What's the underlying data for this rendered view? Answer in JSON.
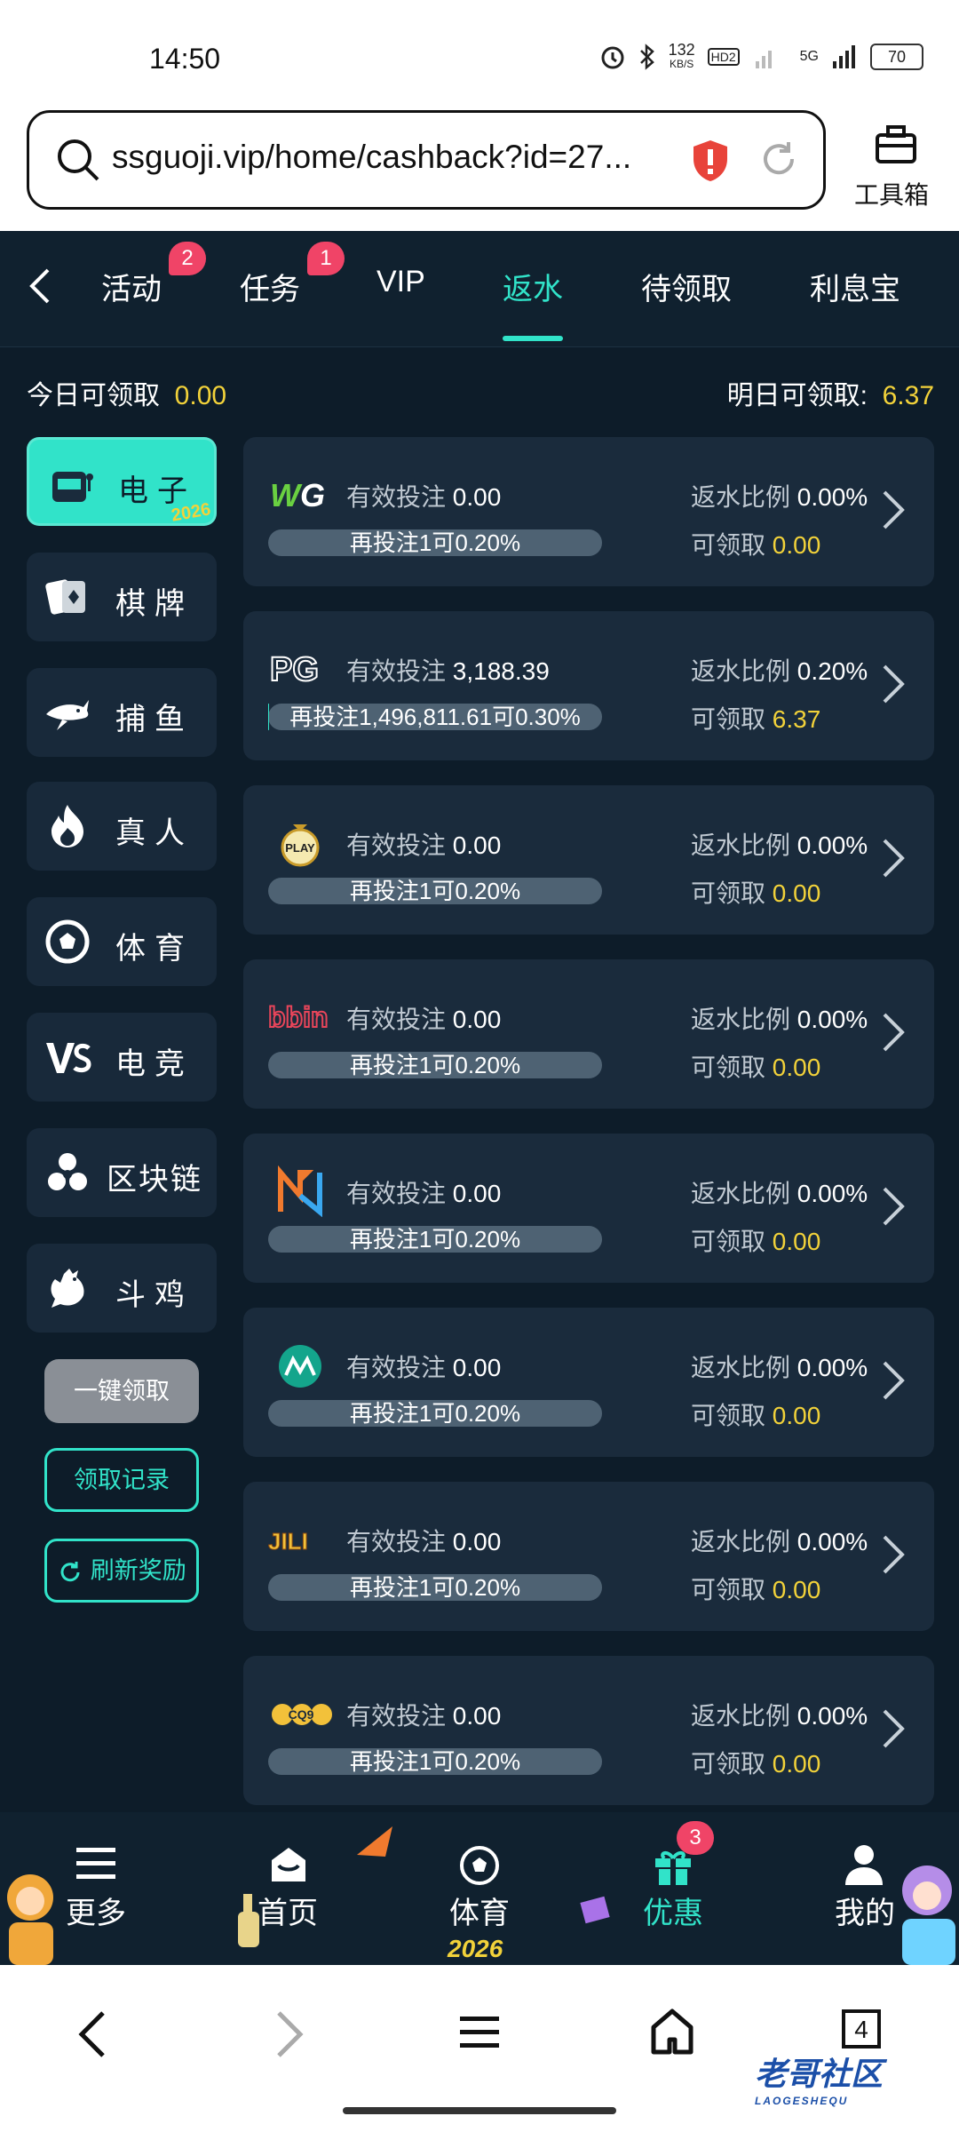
{
  "status": {
    "time": "14:50",
    "speed": "132",
    "speed_unit": "KB/S",
    "hd": "HD2",
    "net": "5G",
    "battery": "70"
  },
  "browser": {
    "url": "ssguoji.vip/home/cashback?id=27...",
    "toolbox": "工具箱"
  },
  "tabs": [
    {
      "label": "活动",
      "badge": "2"
    },
    {
      "label": "任务",
      "badge": "1"
    },
    {
      "label": "VIP"
    },
    {
      "label": "返水",
      "active": true
    },
    {
      "label": "待领取"
    },
    {
      "label": "利息宝"
    }
  ],
  "summary": {
    "today_label": "今日可领取",
    "today_value": "0.00",
    "tomorrow_label": "明日可领取:",
    "tomorrow_value": "6.37"
  },
  "categories": [
    {
      "label": "电子",
      "icon": "slot-machine-icon",
      "active": true,
      "tag": "2026"
    },
    {
      "label": "棋牌",
      "icon": "cards-icon"
    },
    {
      "label": "捕鱼",
      "icon": "shark-icon"
    },
    {
      "label": "真人",
      "icon": "flame-icon"
    },
    {
      "label": "体育",
      "icon": "soccer-ball-icon"
    },
    {
      "label": "电竞",
      "icon": "vs-icon"
    },
    {
      "label": "区块链",
      "icon": "blockchain-icon"
    },
    {
      "label": "斗鸡",
      "icon": "rooster-icon"
    }
  ],
  "actions": {
    "claim_all": "一键领取",
    "records": "领取记录",
    "refresh": "刷新奖励"
  },
  "card_labels": {
    "bet": "有效投注",
    "rate": "返水比例",
    "claimable": "可领取"
  },
  "cards": [
    {
      "logo": "WG",
      "bet": "0.00",
      "hint": "再投注1可0.20%",
      "rate": "0.00%",
      "claimable": "0.00",
      "fill": 0
    },
    {
      "logo": "PG",
      "bet": "3,188.39",
      "hint": "再投注1,496,811.61可0.30%",
      "rate": "0.20%",
      "claimable": "6.37",
      "fill": 0.002
    },
    {
      "logo": "PLAY",
      "bet": "0.00",
      "hint": "再投注1可0.20%",
      "rate": "0.00%",
      "claimable": "0.00",
      "fill": 0
    },
    {
      "logo": "bbin",
      "bet": "0.00",
      "hint": "再投注1可0.20%",
      "rate": "0.00%",
      "claimable": "0.00",
      "fill": 0
    },
    {
      "logo": "N",
      "bet": "0.00",
      "hint": "再投注1可0.20%",
      "rate": "0.00%",
      "claimable": "0.00",
      "fill": 0
    },
    {
      "logo": "M",
      "bet": "0.00",
      "hint": "再投注1可0.20%",
      "rate": "0.00%",
      "claimable": "0.00",
      "fill": 0
    },
    {
      "logo": "JILI",
      "bet": "0.00",
      "hint": "再投注1可0.20%",
      "rate": "0.00%",
      "claimable": "0.00",
      "fill": 0
    },
    {
      "logo": "CQ9",
      "bet": "0.00",
      "hint": "再投注1可0.20%",
      "rate": "0.00%",
      "claimable": "0.00",
      "fill": 0
    }
  ],
  "bottom_nav": [
    {
      "label": "更多",
      "icon": "menu-icon"
    },
    {
      "label": "首页",
      "icon": "home-icon"
    },
    {
      "label": "体育",
      "icon": "soccer-ball-icon"
    },
    {
      "label": "优惠",
      "icon": "gift-icon",
      "active": true,
      "badge": "3"
    },
    {
      "label": "我的",
      "icon": "user-icon"
    }
  ],
  "decor": {
    "year": "2026",
    "watermark": "老哥社区",
    "watermark_sub": "LAOGESHEQU"
  },
  "sysnav": {
    "tabs_count": "4"
  },
  "colors": {
    "accent": "#31e3c9",
    "gold": "#f2d23a",
    "bg": "#0d1c29",
    "card": "#1a2b3c",
    "badge": "#f04467"
  }
}
